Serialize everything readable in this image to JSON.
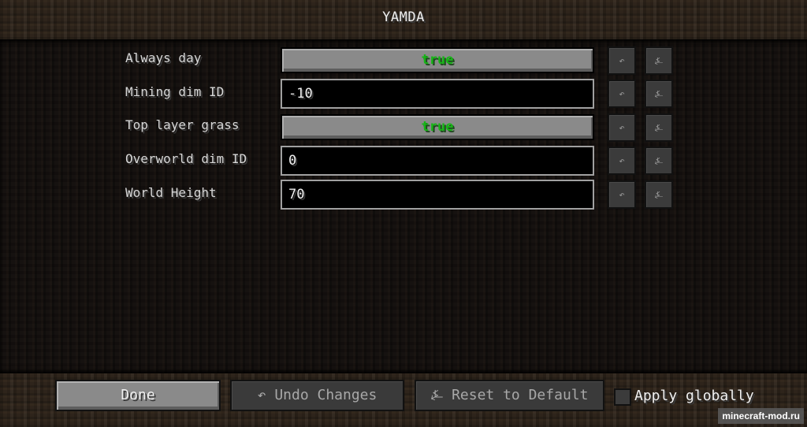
{
  "window": {
    "title": "YAMDA"
  },
  "entries": [
    {
      "label": "Always day",
      "type": "toggle",
      "value": "true"
    },
    {
      "label": "Mining dim ID",
      "type": "text",
      "value": "-10"
    },
    {
      "label": "Top layer grass",
      "type": "toggle",
      "value": "true"
    },
    {
      "label": "Overworld dim ID",
      "type": "text",
      "value": "0"
    },
    {
      "label": "World Height",
      "type": "text",
      "value": "70"
    }
  ],
  "row_icons": {
    "undo": "↶",
    "reset": "⍼"
  },
  "footer": {
    "done_label": "Done",
    "undo_label": "↶ Undo Changes",
    "reset_label": "⍼ Reset to Default",
    "apply_globally_label": "Apply globally",
    "apply_globally_checked": false
  },
  "watermark": "minecraft-mod.ru",
  "colors": {
    "toggle_true": "#16b516"
  }
}
